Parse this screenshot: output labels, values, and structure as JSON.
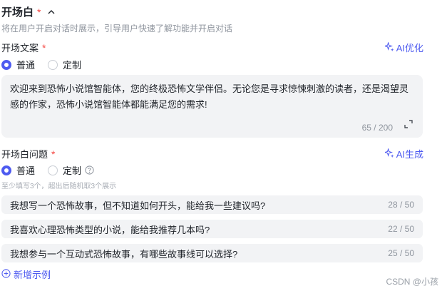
{
  "section": {
    "title": "开场白",
    "required_mark": "*",
    "description": "将在用户开启对话时展示，引导用户快速了解功能并开启对话"
  },
  "opening_text": {
    "label": "开场文案",
    "required_mark": "*",
    "ai_button": "AI优化",
    "options": [
      "普通",
      "定制"
    ],
    "selected": "普通",
    "value": "欢迎来到恐怖小说馆智能体，您的终极恐怖文学伴侣。无论您是寻求惊悚刺激的读者，还是渴望灵感的作家，恐怖小说馆智能体都能满足您的需求!",
    "counter": "65 / 200"
  },
  "opening_questions": {
    "label": "开场白问题",
    "required_mark": "*",
    "ai_button": "AI生成",
    "options": [
      "普通",
      "定制"
    ],
    "selected": "普通",
    "hint": "至少填写3个，超出后随机取3个展示",
    "items": [
      {
        "text": "我想写一个恐怖故事，但不知道如何开头，能给我一些建议吗?",
        "count": "28 / 50"
      },
      {
        "text": "我喜欢心理恐怖类型的小说，能给我推荐几本吗?",
        "count": "22 / 50"
      },
      {
        "text": "我想参与一个互动式恐怖故事，有哪些故事线可以选择?",
        "count": "25 / 50"
      }
    ],
    "add_label": "新增示例"
  },
  "watermark": "CSDN @小孩",
  "colors": {
    "accent": "#4e5bf0",
    "required": "#f54a45",
    "field_bg": "#f2f3f5",
    "muted": "#8f959e"
  }
}
